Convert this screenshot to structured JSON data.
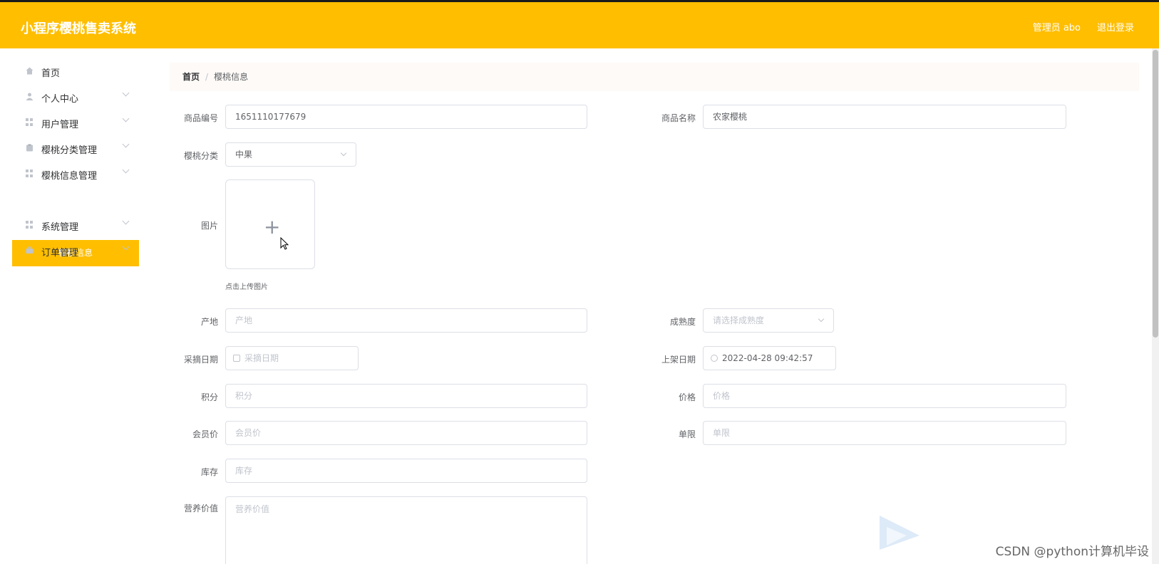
{
  "app": {
    "title": "小程序樱桃售卖系统"
  },
  "header": {
    "user_label": "管理员 abo",
    "logout_label": "退出登录"
  },
  "sidebar": {
    "items": [
      {
        "label": "首页",
        "icon": "home-icon"
      },
      {
        "label": "个人中心",
        "icon": "user-icon"
      },
      {
        "label": "用户管理",
        "icon": "grid-icon"
      },
      {
        "label": "樱桃分类管理",
        "icon": "clipboard-icon"
      },
      {
        "label": "樱桃信息管理",
        "icon": "grid-icon"
      },
      {
        "label": "系统管理",
        "icon": "grid-icon"
      },
      {
        "label": "订单管理",
        "icon": "briefcase-icon"
      }
    ],
    "active_sub": "樱桃信息"
  },
  "breadcrumb": {
    "home": "首页",
    "separator": "/",
    "current": "樱桃信息"
  },
  "form": {
    "product_no": {
      "label": "商品编号",
      "value": "1651110177679"
    },
    "product_name": {
      "label": "商品名称",
      "value": "农家樱桃"
    },
    "category": {
      "label": "樱桃分类",
      "value": "中果"
    },
    "image": {
      "label": "图片",
      "tip": "点击上传图片"
    },
    "origin": {
      "label": "产地",
      "placeholder": "产地"
    },
    "ripeness": {
      "label": "成熟度",
      "placeholder": "请选择成熟度"
    },
    "pick_date": {
      "label": "采摘日期",
      "placeholder": "采摘日期"
    },
    "shelf_date": {
      "label": "上架日期",
      "value": "2022-04-28 09:42:57"
    },
    "points": {
      "label": "积分",
      "placeholder": "积分"
    },
    "price": {
      "label": "价格",
      "placeholder": "价格"
    },
    "member_price": {
      "label": "会员价",
      "placeholder": "会员价"
    },
    "limit": {
      "label": "单限",
      "placeholder": "单限"
    },
    "stock": {
      "label": "库存",
      "placeholder": "库存"
    },
    "nutrition": {
      "label": "营养价值",
      "placeholder": "营养价值"
    }
  },
  "watermark": {
    "text": "CSDN @python计算机毕设"
  },
  "colors": {
    "accent": "#ffbe00"
  }
}
